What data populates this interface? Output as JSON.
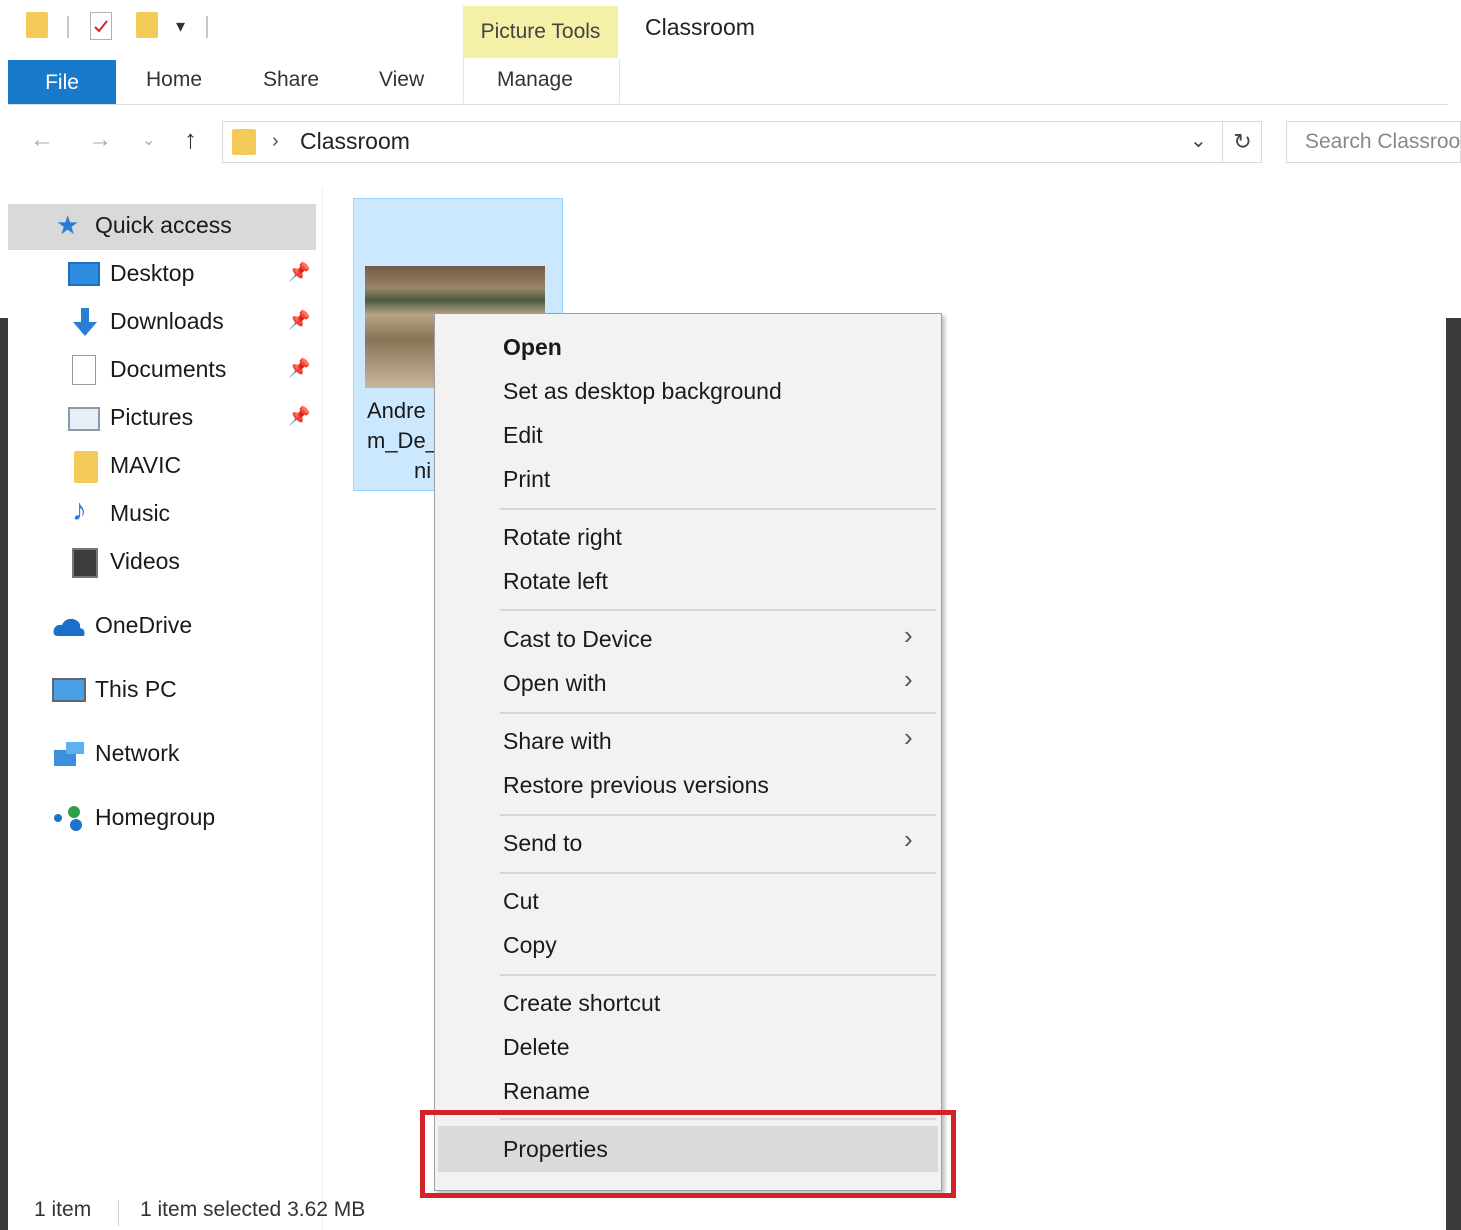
{
  "window": {
    "title": "Classroom",
    "contextual_group": "Picture Tools"
  },
  "ribbon": {
    "tabs": [
      "File",
      "Home",
      "Share",
      "View",
      "Manage"
    ]
  },
  "address_bar": {
    "path_segment": "Classroom",
    "search_placeholder": "Search Classroom"
  },
  "nav_pane": {
    "quick_access": "Quick access",
    "pinned": [
      {
        "label": "Desktop",
        "icon": "desktop-icon"
      },
      {
        "label": "Downloads",
        "icon": "download-arrow-icon"
      },
      {
        "label": "Documents",
        "icon": "documents-icon"
      },
      {
        "label": "Pictures",
        "icon": "pictures-icon"
      }
    ],
    "recent": [
      {
        "label": "MAVIC",
        "icon": "folder-icon"
      },
      {
        "label": "Music",
        "icon": "music-note-icon"
      },
      {
        "label": "Videos",
        "icon": "videos-icon"
      }
    ],
    "locations": [
      {
        "label": "OneDrive",
        "icon": "cloud-icon"
      },
      {
        "label": "This PC",
        "icon": "computer-icon"
      },
      {
        "label": "Network",
        "icon": "network-icon"
      },
      {
        "label": "Homegroup",
        "icon": "homegroup-icon"
      }
    ]
  },
  "file": {
    "name_line1": "Andre",
    "name_line2": "m_De_",
    "name_line3": "ni"
  },
  "context_menu": {
    "items": [
      {
        "label": "Open",
        "bold": true
      },
      {
        "label": "Set as desktop background"
      },
      {
        "label": "Edit"
      },
      {
        "label": "Print"
      },
      {
        "label": "Rotate right"
      },
      {
        "label": "Rotate left"
      },
      {
        "label": "Cast to Device",
        "submenu": true
      },
      {
        "label": "Open with",
        "submenu": true
      },
      {
        "label": "Share with",
        "submenu": true
      },
      {
        "label": "Restore previous versions"
      },
      {
        "label": "Send to",
        "submenu": true
      },
      {
        "label": "Cut"
      },
      {
        "label": "Copy"
      },
      {
        "label": "Create shortcut"
      },
      {
        "label": "Delete"
      },
      {
        "label": "Rename"
      },
      {
        "label": "Properties",
        "highlighted": true
      }
    ]
  },
  "status_bar": {
    "item_count": "1 item",
    "selection": "1 item selected  3.62 MB"
  },
  "colors": {
    "file_tab": "#1979ca",
    "picture_tools": "#f4f0a8",
    "selection": "#cce8ff",
    "highlight_box": "#d2232a"
  }
}
